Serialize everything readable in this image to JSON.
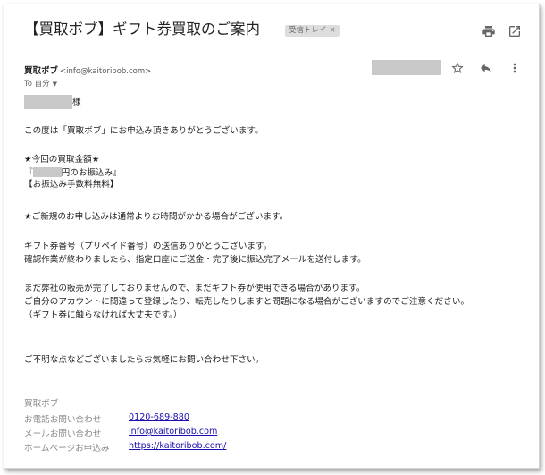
{
  "email": {
    "subject": "【買取ボブ】ギフト券買取のご案内",
    "label_tag": "受信トレイ",
    "label_close": "×",
    "sender_name": "買取ボブ",
    "sender_email": "<info@kaitoribob.com>",
    "to_label": "To 自分",
    "to_caret": "▼"
  },
  "body": {
    "greeting_suffix": "様",
    "line_thanks": "この度は「買取ボブ」にお申込み頂きありがとうございます。",
    "amount_heading": "★今回の買取金額★",
    "amount_open": "『",
    "amount_close": "円のお振込み』",
    "fee_note": "【お振込み手数料無料】",
    "notice_new": "★ご新規のお申し込みは通常よりお時間がかかる場合がございます。",
    "received_1": "ギフト券番号（プリペイド番号）の送信ありがとうございます。",
    "received_2": "確認作業が終わりましたら、指定口座にご送金・完了後に振込完了メールを送付します。",
    "warn_1": "まだ弊社の販売が完了しておりませんので、まだギフト券が使用できる場合があります。",
    "warn_2": "ご自分のアカウントに間違って登録したり、転売したりしますと問題になる場合がございますのでご注意ください。",
    "warn_3": "（ギフト券に触らなければ大丈夫です。）",
    "closing": "ご不明な点などございましたらお気軽にお問い合わせ下さい。"
  },
  "signature": {
    "company": "買取ボブ",
    "phone_label": "お電話お問い合わせ",
    "phone_value": "0120-689-880",
    "mail_label": "メールお問い合わせ",
    "mail_value": "info@kaitoribob.com",
    "web_label": "ホームページお申込み",
    "web_value": "https://kaitoribob.com/"
  },
  "icons": {
    "print": "print-icon",
    "open_new_window": "open-in-new-icon",
    "star": "star-icon",
    "reply": "reply-icon",
    "more": "more-vert-icon"
  },
  "colors": {
    "link": "#1a0dab",
    "label_gray": "#888888",
    "redaction": "#c8c8c8",
    "tag_bg": "#dddddd"
  }
}
